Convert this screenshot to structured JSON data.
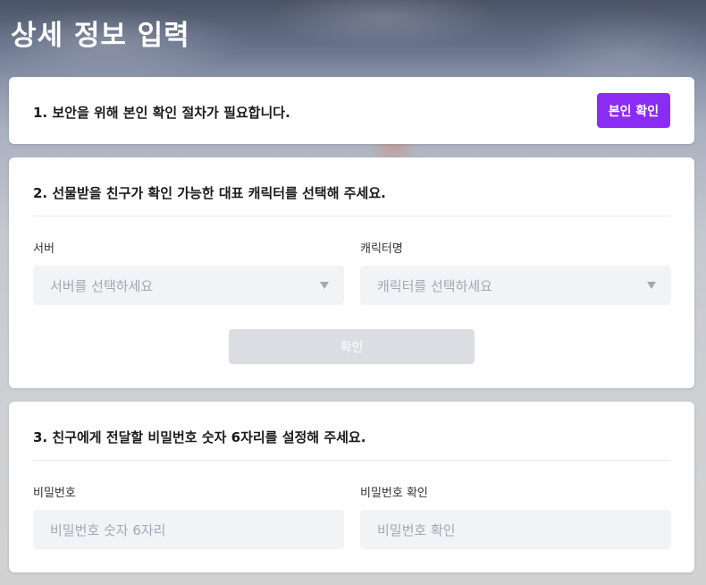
{
  "page": {
    "title": "상세 정보 입력"
  },
  "step1": {
    "title": "1. 보안을 위해 본인 확인 절차가 필요합니다.",
    "verify_button": "본인 확인",
    "accent_color": "#8b2cf5"
  },
  "step2": {
    "title": "2. 선물받을 친구가 확인 가능한 대표 캐릭터를 선택해 주세요.",
    "server_label": "서버",
    "server_placeholder": "서버를 선택하세요",
    "character_label": "캐릭터명",
    "character_placeholder": "캐릭터를 선택하세요",
    "confirm_button": "확인",
    "dropdown_icon": "chevron-down-icon"
  },
  "step3": {
    "title": "3. 친구에게 전달할 비밀번호 숫자 6자리를 설정해 주세요.",
    "password_label": "비밀번호",
    "password_placeholder": "비밀번호 숫자 6자리",
    "password_confirm_label": "비밀번호 확인",
    "password_confirm_placeholder": "비밀번호 확인"
  }
}
